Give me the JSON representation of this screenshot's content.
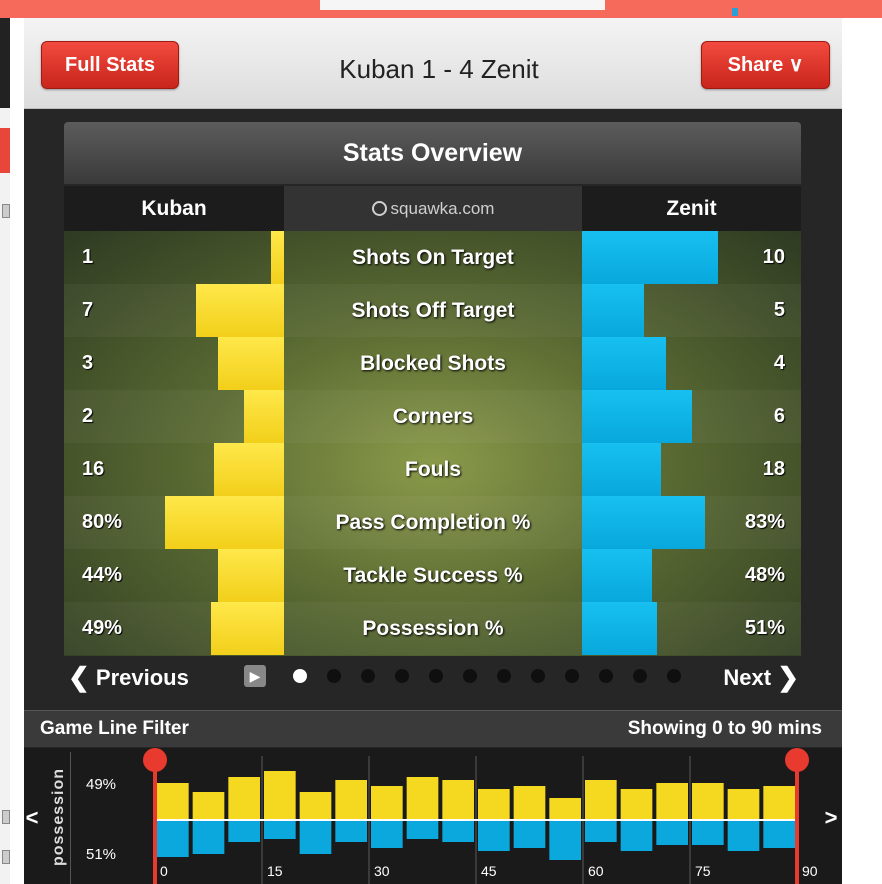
{
  "header": {
    "full_stats_label": "Full Stats",
    "match_title": "Kuban 1 - 4 Zenit",
    "share_label": "Share ∨"
  },
  "overview": {
    "title": "Stats Overview",
    "home_team": "Kuban",
    "away_team": "Zenit",
    "brand": "squawka.com",
    "rows": [
      {
        "label": "Shots On Target",
        "home": "1",
        "away": "10",
        "home_frac": 0.06,
        "away_frac": 0.62
      },
      {
        "label": "Shots Off Target",
        "home": "7",
        "away": "5",
        "home_frac": 0.4,
        "away_frac": 0.28
      },
      {
        "label": "Blocked Shots",
        "home": "3",
        "away": "4",
        "home_frac": 0.3,
        "away_frac": 0.38
      },
      {
        "label": "Corners",
        "home": "2",
        "away": "6",
        "home_frac": 0.18,
        "away_frac": 0.5
      },
      {
        "label": "Fouls",
        "home": "16",
        "away": "18",
        "home_frac": 0.32,
        "away_frac": 0.36
      },
      {
        "label": "Pass Completion %",
        "home": "80%",
        "away": "83%",
        "home_frac": 0.54,
        "away_frac": 0.56
      },
      {
        "label": "Tackle Success %",
        "home": "44%",
        "away": "48%",
        "home_frac": 0.3,
        "away_frac": 0.32
      },
      {
        "label": "Possession %",
        "home": "49%",
        "away": "51%",
        "home_frac": 0.33,
        "away_frac": 0.34
      }
    ]
  },
  "nav": {
    "previous_label": "Previous",
    "next_label": "Next",
    "page_count": 12,
    "active_page": 1
  },
  "filter": {
    "label": "Game Line Filter",
    "showing": "Showing 0 to 90 mins"
  },
  "timeline": {
    "axis_label": "possession",
    "home_pct": "49%",
    "away_pct": "51%",
    "ticks": [
      "0",
      "15",
      "30",
      "45",
      "60",
      "75",
      "90"
    ],
    "home_possession": [
      0.6,
      0.45,
      0.7,
      0.8,
      0.45,
      0.65,
      0.55,
      0.7,
      0.65,
      0.5,
      0.55,
      0.35,
      0.65,
      0.5,
      0.6,
      0.6,
      0.5,
      0.55
    ],
    "away_possession": [
      0.6,
      0.55,
      0.35,
      0.3,
      0.55,
      0.35,
      0.45,
      0.3,
      0.35,
      0.5,
      0.45,
      0.65,
      0.35,
      0.5,
      0.4,
      0.4,
      0.5,
      0.45
    ],
    "colors": {
      "home": "#f5d820",
      "away": "#0aa8dc",
      "marker": "#e83a2e"
    }
  }
}
